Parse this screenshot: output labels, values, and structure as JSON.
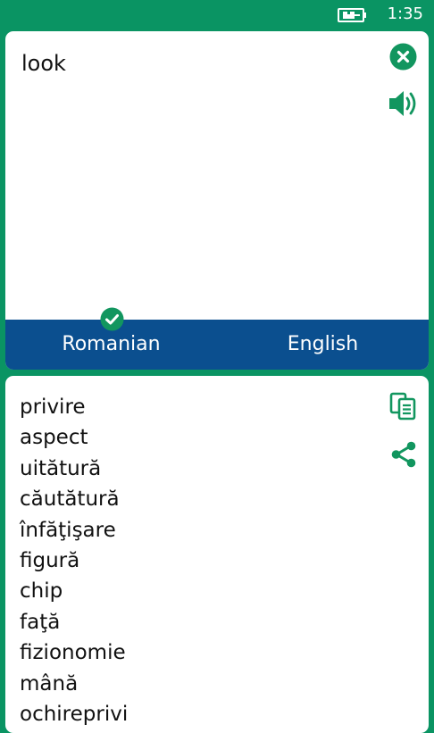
{
  "status": {
    "time": "1:35",
    "battery_icon": "battery-charging-icon"
  },
  "input": {
    "text": "look",
    "clear_icon": "close-circle-icon",
    "speaker_icon": "speaker-icon"
  },
  "languages": {
    "source": "Romanian",
    "target": "English",
    "selected": "source",
    "selected_icon": "check-circle-icon"
  },
  "output": {
    "copy_icon": "copy-icon",
    "share_icon": "share-icon",
    "translations": [
      "privire",
      "aspect",
      "uitătură",
      "căutătură",
      "înfăţişare",
      "figură",
      "chip",
      "faţă",
      "fizionomie",
      "mână",
      "ochireprivi"
    ]
  },
  "colors": {
    "background": "#0a9463",
    "accent_icon": "#12965f",
    "language_bar": "#0b4f8f",
    "card": "#ffffff"
  }
}
